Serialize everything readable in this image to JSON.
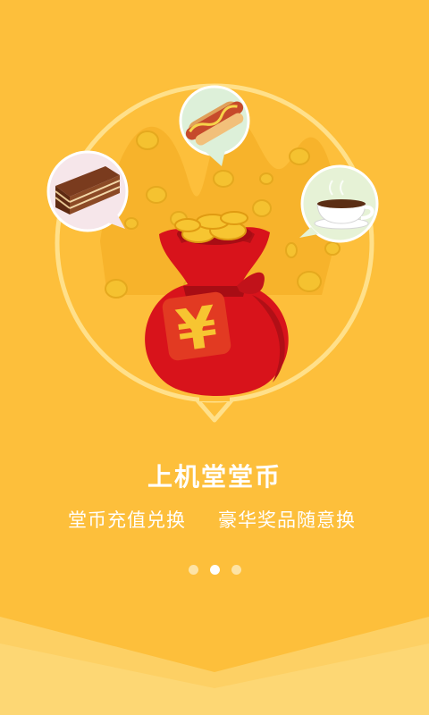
{
  "illustration": {
    "bag_symbol": "¥",
    "bubbles": [
      "hotdog-icon",
      "cake-icon",
      "coffee-cup-icon"
    ],
    "colors": {
      "background": "#FDBF3B",
      "bag": "#D8131B",
      "coin": "#F5C230",
      "ring": "#FFE08A"
    }
  },
  "onboarding": {
    "title": "上机堂堂币",
    "subtitle_left": "堂币充值兑换",
    "subtitle_right": "豪华奖品随意换",
    "pager": {
      "total": 3,
      "active_index": 2
    }
  }
}
